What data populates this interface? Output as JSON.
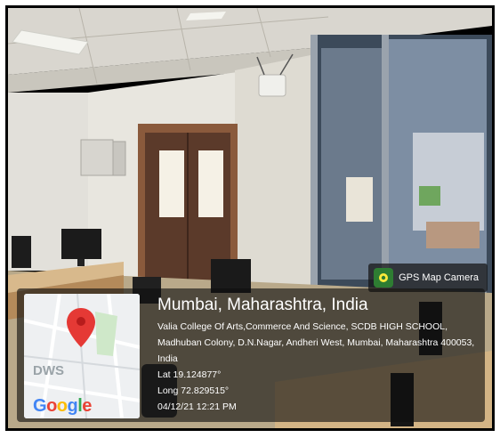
{
  "badge": {
    "label": "GPS Map Camera",
    "icon": "map-pin-camera-icon"
  },
  "map": {
    "label": "DWS",
    "brand": [
      "G",
      "o",
      "o",
      "g",
      "l",
      "e"
    ],
    "pin_color": "#e53935"
  },
  "location": {
    "title": "Mumbai, Maharashtra, India",
    "address_line1": "Valia College Of Arts,Commerce And Science, SCDB HIGH SCHOOL,",
    "address_line2": "Madhuban Colony, D.N.Nagar, Andheri West, Mumbai, Maharashtra 400053,",
    "address_line3": "India",
    "lat": "Lat 19.124877°",
    "long": "Long 72.829515°",
    "datetime": "04/12/21 12:21 PM"
  }
}
